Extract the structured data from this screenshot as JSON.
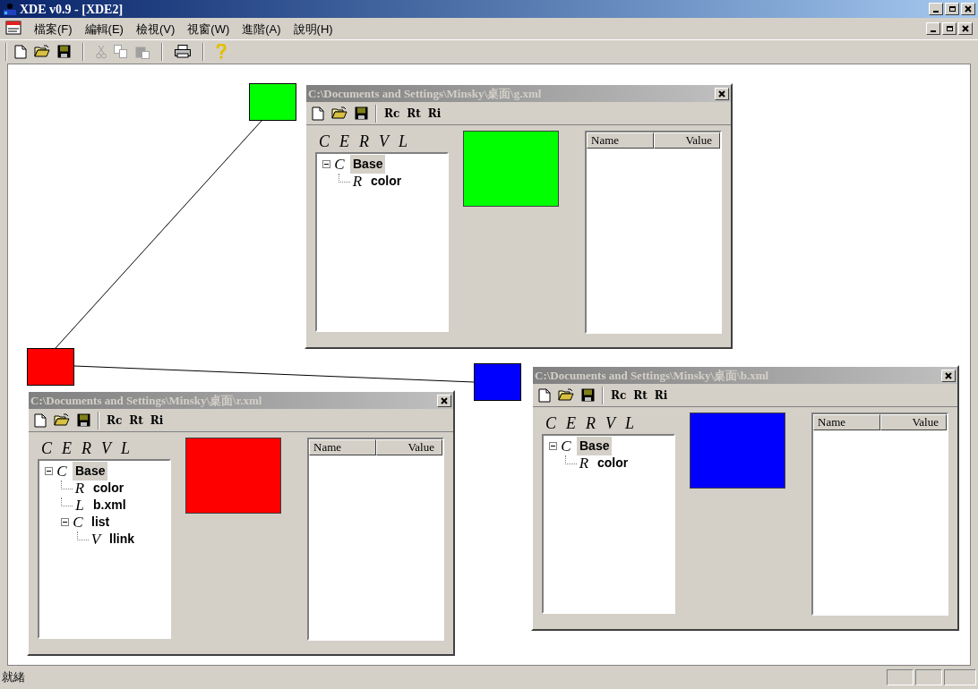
{
  "window": {
    "title": "XDE v0.9 - [XDE2]"
  },
  "menu": [
    "檔案(F)",
    "編輯(E)",
    "檢視(V)",
    "視窗(W)",
    "進階(A)",
    "說明(H)"
  ],
  "toolbar": [
    {
      "kind": "new",
      "disabled": false
    },
    {
      "kind": "open",
      "disabled": false
    },
    {
      "kind": "save",
      "disabled": false
    },
    {
      "kind": "separator"
    },
    {
      "kind": "cut",
      "disabled": true
    },
    {
      "kind": "copy",
      "disabled": true
    },
    {
      "kind": "paste",
      "disabled": true
    },
    {
      "kind": "separator"
    },
    {
      "kind": "print",
      "disabled": false
    },
    {
      "kind": "separator"
    },
    {
      "kind": "help",
      "disabled": false
    }
  ],
  "canvas": {
    "nodes": [
      {
        "color": "#00ff00"
      },
      {
        "color": "#ff0000"
      },
      {
        "color": "#0000ff"
      }
    ]
  },
  "documents": [
    {
      "title": "C:\\Documents and Settings\\Minsky\\桌面\\g.xml",
      "toolbar_buttons": [
        "Rc",
        "Rt",
        "Ri"
      ],
      "palette": [
        "C",
        "E",
        "R",
        "V",
        "L"
      ],
      "swatch": {
        "color": "#00ff00"
      },
      "columns": [
        "Name",
        "Value"
      ],
      "tree": [
        {
          "icon": "C",
          "label": "Base",
          "selected": true,
          "expanded": true,
          "children": [
            {
              "icon": "R",
              "label": "color",
              "selected": false
            }
          ]
        }
      ]
    },
    {
      "title": "C:\\Documents and Settings\\Minsky\\桌面\\r.xml",
      "toolbar_buttons": [
        "Rc",
        "Rt",
        "Ri"
      ],
      "palette": [
        "C",
        "E",
        "R",
        "V",
        "L"
      ],
      "swatch": {
        "color": "#ff0000"
      },
      "columns": [
        "Name",
        "Value"
      ],
      "tree": [
        {
          "icon": "C",
          "label": "Base",
          "selected": true,
          "expanded": true,
          "children": [
            {
              "icon": "R",
              "label": "color",
              "selected": false
            },
            {
              "icon": "L",
              "label": "b.xml",
              "selected": false
            },
            {
              "icon": "C",
              "label": "list",
              "selected": false,
              "expanded": true,
              "children": [
                {
                  "icon": "V",
                  "label": "llink",
                  "selected": false
                }
              ]
            }
          ]
        }
      ]
    },
    {
      "title": "C:\\Documents and Settings\\Minsky\\桌面\\b.xml",
      "toolbar_buttons": [
        "Rc",
        "Rt",
        "Ri"
      ],
      "palette": [
        "C",
        "E",
        "R",
        "V",
        "L"
      ],
      "swatch": {
        "color": "#0000ff"
      },
      "columns": [
        "Name",
        "Value"
      ],
      "tree": [
        {
          "icon": "C",
          "label": "Base",
          "selected": true,
          "expanded": true,
          "children": [
            {
              "icon": "R",
              "label": "color",
              "selected": false
            }
          ]
        }
      ]
    }
  ],
  "status_bar": {
    "text": "就緒"
  }
}
